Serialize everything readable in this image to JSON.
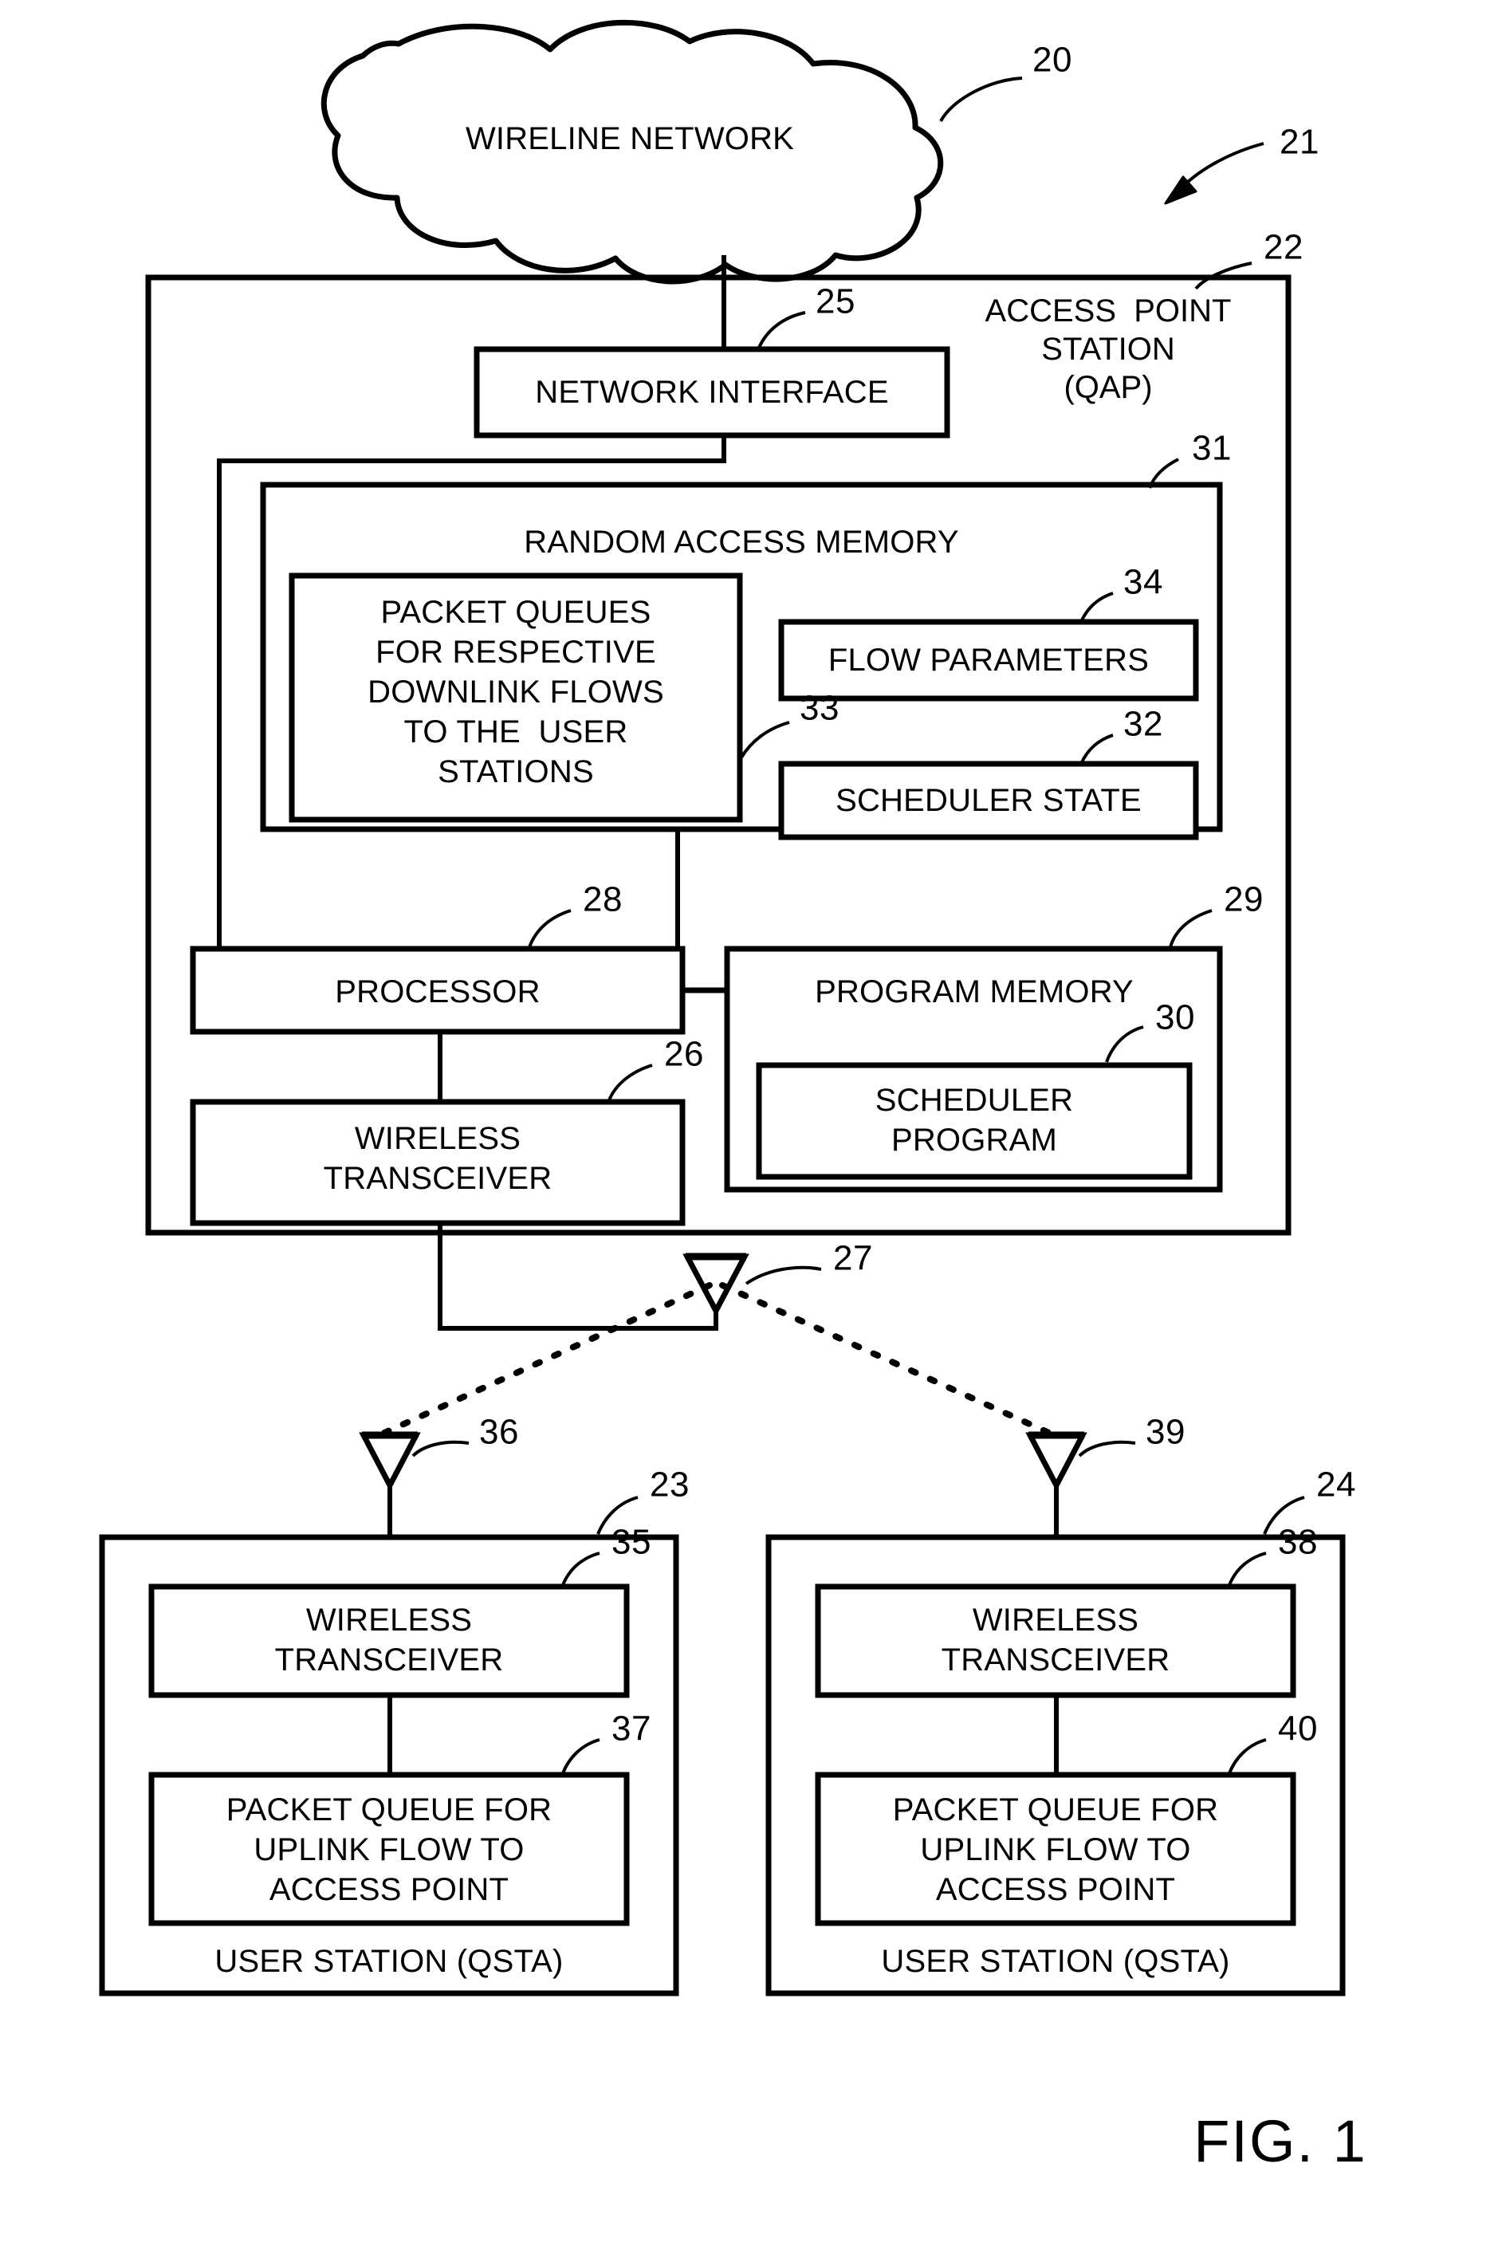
{
  "figure": {
    "caption": "FIG. 1",
    "system_ref": "21"
  },
  "cloud": {
    "label": "WIRELINE NETWORK",
    "ref": "20"
  },
  "access_point": {
    "title_line1": "ACCESS  POINT",
    "title_line2": "STATION",
    "title_line3": "(QAP)",
    "ref": "22",
    "network_interface": {
      "label": "NETWORK INTERFACE",
      "ref": "25"
    },
    "random_access_memory": {
      "label": "RANDOM ACCESS MEMORY",
      "ref": "31",
      "packet_queues": {
        "line1": "PACKET QUEUES",
        "line2": "FOR RESPECTIVE",
        "line3": "DOWNLINK FLOWS",
        "line4": "TO THE  USER",
        "line5": "STATIONS",
        "ref": "33"
      },
      "flow_parameters": {
        "label": "FLOW PARAMETERS",
        "ref": "34"
      },
      "scheduler_state": {
        "label": "SCHEDULER STATE",
        "ref": "32"
      }
    },
    "processor": {
      "label": "PROCESSOR",
      "ref": "28"
    },
    "program_memory": {
      "label": "PROGRAM MEMORY",
      "ref": "29",
      "scheduler_program": {
        "line1": "SCHEDULER",
        "line2": "PROGRAM",
        "ref": "30"
      }
    },
    "wireless_transceiver": {
      "line1": "WIRELESS",
      "line2": "TRANSCEIVER",
      "ref": "26"
    },
    "antenna": {
      "ref": "27"
    }
  },
  "user_station_left": {
    "label": "USER STATION (QSTA)",
    "ref": "23",
    "antenna_ref": "36",
    "wireless_transceiver": {
      "line1": "WIRELESS",
      "line2": "TRANSCEIVER",
      "ref": "35"
    },
    "packet_queue": {
      "line1": "PACKET QUEUE FOR",
      "line2": "UPLINK FLOW TO",
      "line3": "ACCESS POINT",
      "ref": "37"
    }
  },
  "user_station_right": {
    "label": "USER STATION (QSTA)",
    "ref": "24",
    "antenna_ref": "39",
    "wireless_transceiver": {
      "line1": "WIRELESS",
      "line2": "TRANSCEIVER",
      "ref": "38"
    },
    "packet_queue": {
      "line1": "PACKET QUEUE FOR",
      "line2": "UPLINK FLOW TO",
      "line3": "ACCESS POINT",
      "ref": "40"
    }
  },
  "colors": {
    "ink": "#000000",
    "paper": "#ffffff"
  }
}
